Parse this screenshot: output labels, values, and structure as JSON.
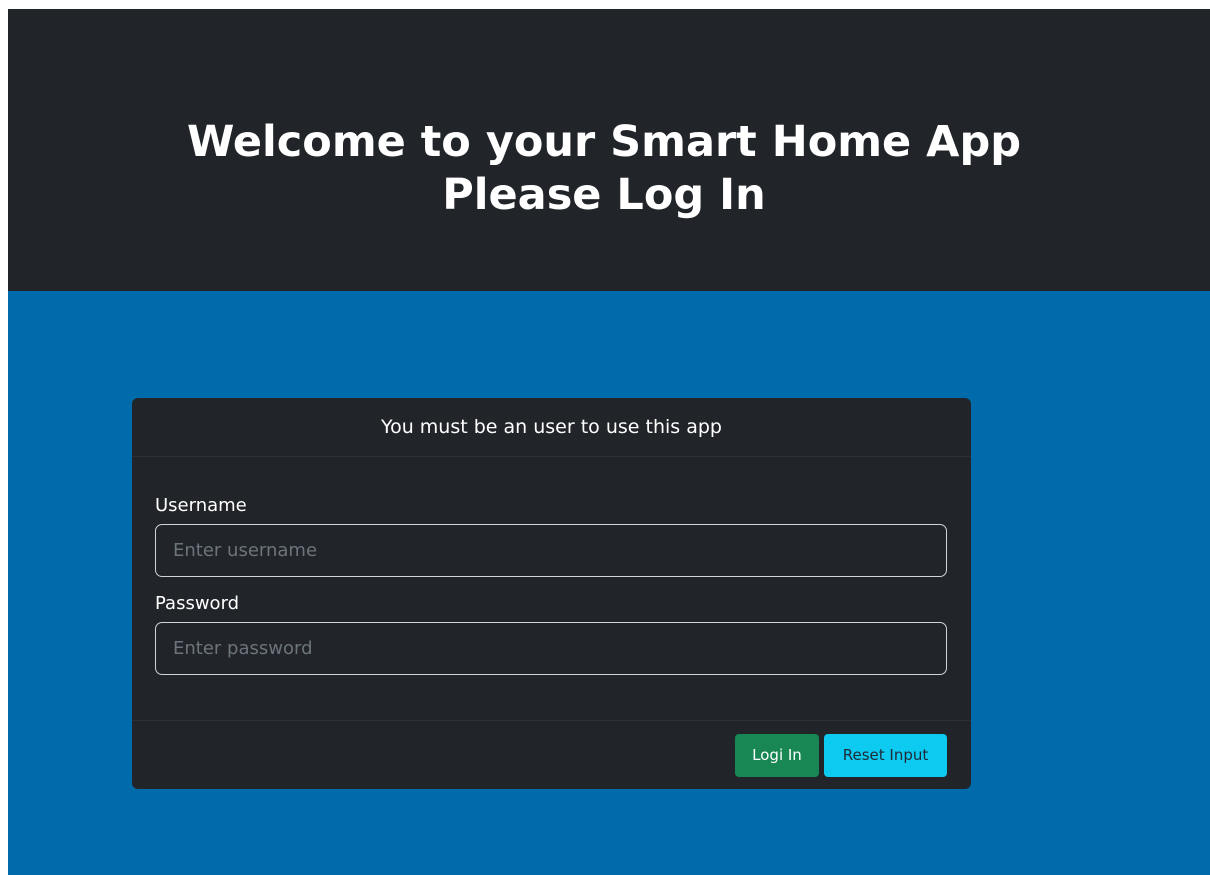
{
  "header": {
    "title_line1": "Welcome to your Smart Home App",
    "title_line2": "Please Log In"
  },
  "card": {
    "header_text": "You must be an user to use this app",
    "username": {
      "label": "Username",
      "placeholder": "Enter username",
      "value": ""
    },
    "password": {
      "label": "Password",
      "placeholder": "Enter password",
      "value": ""
    },
    "buttons": {
      "login_label": "Logi In",
      "reset_label": "Reset Input"
    }
  },
  "colors": {
    "header_background": "#212529",
    "page_background": "#006bab",
    "login_button": "#198754",
    "reset_button": "#0dcaf0"
  }
}
